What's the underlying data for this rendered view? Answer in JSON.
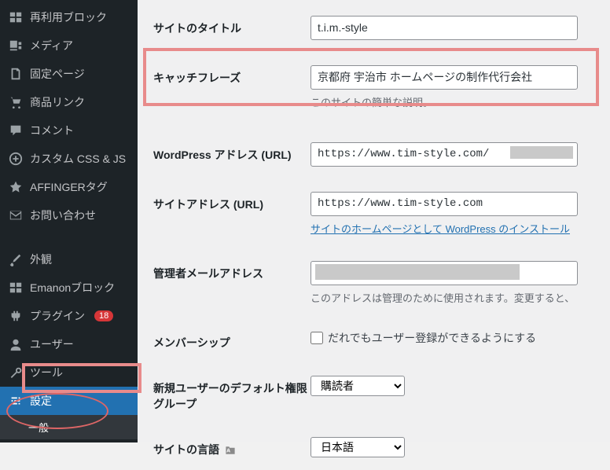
{
  "sidebar": {
    "items": [
      {
        "label": "再利用ブロック"
      },
      {
        "label": "メディア"
      },
      {
        "label": "固定ページ"
      },
      {
        "label": "商品リンク"
      },
      {
        "label": "コメント"
      },
      {
        "label": "カスタム CSS & JS"
      },
      {
        "label": "AFFINGERタグ"
      },
      {
        "label": "お問い合わせ"
      },
      {
        "label": "外観"
      },
      {
        "label": "Emanonブロック"
      },
      {
        "label": "プラグイン",
        "badge": "18"
      },
      {
        "label": "ユーザー"
      },
      {
        "label": "ツール"
      },
      {
        "label": "設定"
      }
    ],
    "submenu": {
      "general": "一般"
    }
  },
  "settings": {
    "site_title": {
      "label": "サイトのタイトル",
      "value": "t.i.m.-style"
    },
    "tagline": {
      "label": "キャッチフレーズ",
      "value": "京都府 宇治市 ホームページの制作代行会社",
      "description": "このサイトの簡単な説明。"
    },
    "wp_address": {
      "label": "WordPress アドレス (URL)",
      "value": "https://www.tim-style.com/"
    },
    "site_address": {
      "label": "サイトアドレス (URL)",
      "value": "https://www.tim-style.com",
      "help_link": "サイトのホームページとして WordPress のインストール"
    },
    "admin_email": {
      "label": "管理者メールアドレス",
      "description": "このアドレスは管理のために使用されます。変更すると、"
    },
    "membership": {
      "label": "メンバーシップ",
      "checkbox_label": "だれでもユーザー登録ができるようにする"
    },
    "default_role": {
      "label": "新規ユーザーのデフォルト権限グループ",
      "value": "購読者"
    },
    "site_language": {
      "label": "サイトの言語",
      "value": "日本語"
    }
  }
}
